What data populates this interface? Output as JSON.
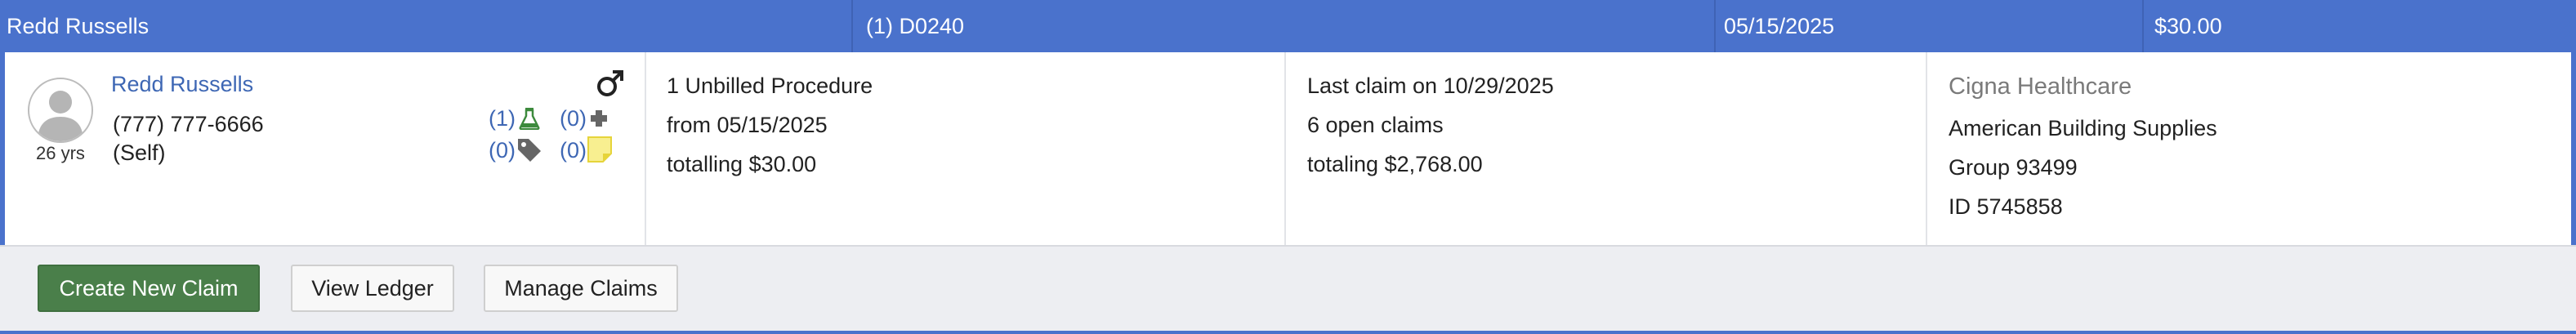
{
  "header": {
    "patient_name": "Redd Russells",
    "procedure": "(1) D0240",
    "date": "05/15/2025",
    "amount": "$30.00"
  },
  "patient": {
    "name": "Redd Russells",
    "age": "26 yrs",
    "phone": "(777) 777-6666",
    "relationship": "(Self)",
    "gender_icon": "male-symbol",
    "counters": {
      "lab": "(1)",
      "medical": "(0)",
      "tags": "(0)",
      "notes": "(0)"
    },
    "colors": {
      "lab_icon": "#3d8a3d",
      "note_icon": "#f3e35a"
    }
  },
  "unbilled": {
    "line1": "1 Unbilled Procedure",
    "line2": "from 05/15/2025",
    "line3": "totalling $30.00"
  },
  "claims": {
    "line1": "Last claim on 10/29/2025",
    "line2": "6 open claims",
    "line3": "totaling $2,768.00"
  },
  "insurance": {
    "carrier": "Cigna Healthcare",
    "employer": "American Building Supplies",
    "group": "Group 93499",
    "member_id": "ID 5745858"
  },
  "actions": {
    "create_new_claim": "Create New Claim",
    "view_ledger": "View Ledger",
    "manage_claims": "Manage Claims"
  },
  "colors": {
    "header_bg": "#4a72cc",
    "primary_button": "#4a7f4a",
    "link": "#3e67b4"
  }
}
